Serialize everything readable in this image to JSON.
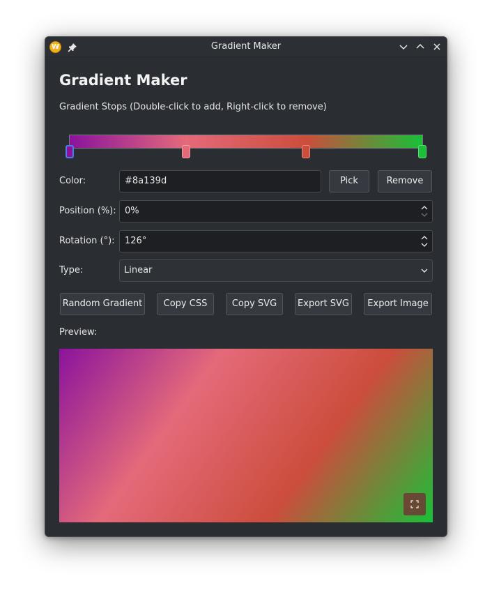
{
  "window": {
    "title": "Gradient Maker",
    "icon_letter": "W"
  },
  "heading": "Gradient Maker",
  "stops_hint": "Gradient Stops (Double-click to add, Right-click to remove)",
  "stops": [
    {
      "position": 0,
      "color": "#8a139d",
      "selected": true
    },
    {
      "position": 33,
      "color": "#e46a7a"
    },
    {
      "position": 67,
      "color": "#cc4d3c"
    },
    {
      "position": 100,
      "color": "#19c038"
    }
  ],
  "color_row": {
    "label": "Color:",
    "value": "#8a139d",
    "pick_label": "Pick",
    "remove_label": "Remove"
  },
  "position_row": {
    "label": "Position (%):",
    "value": "0%"
  },
  "rotation_row": {
    "label": "Rotation (°):",
    "value": "126°"
  },
  "type_row": {
    "label": "Type:",
    "value": "Linear"
  },
  "actions": {
    "random_label": "Random Gradient",
    "copy_css_label": "Copy CSS",
    "copy_svg_label": "Copy SVG",
    "export_svg_label": "Export SVG",
    "export_image_label": "Export Image"
  },
  "preview_label": "Preview:",
  "icons": {
    "app": "app-logo-icon",
    "pin": "pin-icon",
    "minimize": "chevron-down-icon",
    "maximize": "chevron-up-icon",
    "close": "close-icon",
    "fullscreen": "fullscreen-icon"
  },
  "colors": {
    "window_bg": "#2a2d32",
    "accent": "#4d7ee8"
  }
}
